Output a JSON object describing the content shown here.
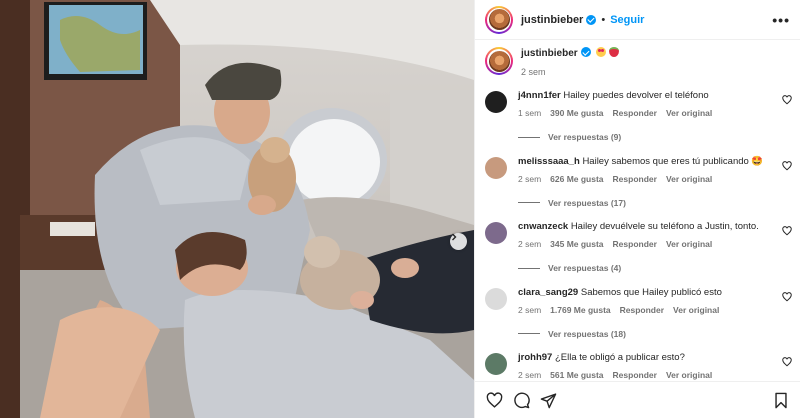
{
  "post": {
    "username": "justinbieber",
    "follow_label": "Seguir",
    "header_separator": "•",
    "more_label": "•••",
    "caption_time": "2 sem",
    "caption_emojis": [
      "heart-eyes-emoji",
      "strawberry-emoji"
    ]
  },
  "comments": [
    {
      "user": "j4nnn1fer",
      "text": "Hailey puedes devolver el teléfono",
      "time": "1 sem",
      "likes": "390 Me gusta",
      "reply": "Responder",
      "translate": "Ver original",
      "replies": "Ver respuestas (9)",
      "avatar_color": "#1f1f1f"
    },
    {
      "user": "melisssaaa_h",
      "text": "Hailey sabemos que eres tú publicando 🤩",
      "time": "2 sem",
      "likes": "626 Me gusta",
      "reply": "Responder",
      "translate": "Ver original",
      "replies": "Ver respuestas (17)",
      "avatar_color": "#c79a7e"
    },
    {
      "user": "cnwanzeck",
      "text": "Hailey devuélvele su teléfono a Justin, tonto.",
      "time": "2 sem",
      "likes": "345 Me gusta",
      "reply": "Responder",
      "translate": "Ver original",
      "replies": "Ver respuestas (4)",
      "avatar_color": "#7d6a8c"
    },
    {
      "user": "clara_sang29",
      "text": "Sabemos que Hailey publicó esto",
      "time": "2 sem",
      "likes": "1.769 Me gusta",
      "reply": "Responder",
      "translate": "Ver original",
      "replies": "Ver respuestas (18)",
      "avatar_color": "#dbdbdb"
    },
    {
      "user": "jrohh97",
      "text": "¿Ella te obligó a publicar esto?",
      "time": "2 sem",
      "likes": "561 Me gusta",
      "reply": "Responder",
      "translate": "Ver original",
      "replies": "",
      "avatar_color": "#5c7a66"
    }
  ],
  "colors": {
    "accent": "#0095f6",
    "secondary_text": "#737373",
    "primary_text": "#262626"
  },
  "icons": [
    "heart-icon",
    "comment-icon",
    "share-icon",
    "bookmark-icon",
    "verified-icon",
    "more-icon",
    "chevron-right-icon"
  ]
}
